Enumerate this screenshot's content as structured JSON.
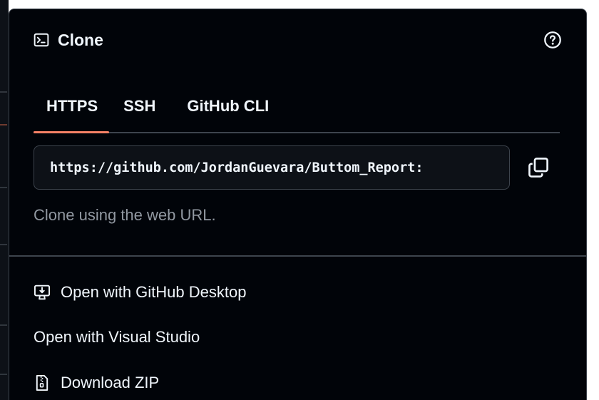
{
  "dropdown": {
    "title": "Clone",
    "icons": {
      "title_icon": "terminal-icon",
      "help": "question-circle-icon",
      "copy": "copy-icon",
      "desktop": "desktop-download-icon",
      "zip": "file-zip-icon"
    },
    "tabs": [
      {
        "label": "HTTPS",
        "selected": true
      },
      {
        "label": "SSH",
        "selected": false
      },
      {
        "label": "GitHub CLI",
        "selected": false
      }
    ],
    "url_value": "https://github.com/JordanGuevara/Buttom_Report:",
    "hint": "Clone using the web URL.",
    "menu": {
      "desktop": "Open with GitHub Desktop",
      "visual_studio": "Open with Visual Studio",
      "zip": "Download ZIP"
    }
  },
  "colors": {
    "panel_bg": "#010409",
    "text": "#f0f6fc",
    "muted": "#9198a1",
    "border": "#3d444d",
    "tab_underline": "#f78166"
  }
}
